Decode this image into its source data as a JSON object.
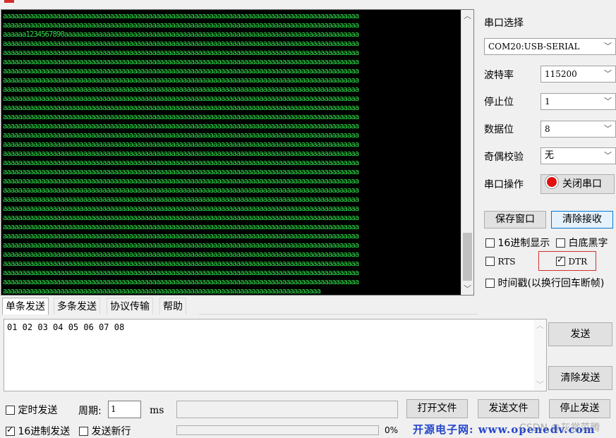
{
  "receive": {
    "lines": [
      "aaaaaaaaaaaaaaaaaaaaaaaaaaaaaaaaaaaaaaaaaaaaaaaaaaaaaaaaaaaaaaaaaaaaaaaaaaaaaaaaaaaaaaaaaaaaa",
      "aaaaaaaaaaaaaaaaaaaaaaaaaaaaaaaaaaaaaaaaaaaaaaaaaaaaaaaaaaaaaaaaaaaaaaaaaaaaaaaaaaaaaaaaaaaaa",
      "aaaaaa1234567890aaaaaaaaaaaaaaaaaaaaaaaaaaaaaaaaaaaaaaaaaaaaaaaaaaaaaaaaaaaaaaaaaaaaaaaaaaaaa",
      "aaaaaaaaaaaaaaaaaaaaaaaaaaaaaaaaaaaaaaaaaaaaaaaaaaaaaaaaaaaaaaaaaaaaaaaaaaaaaaaaaaaaaaaaaaaaa",
      "aaaaaaaaaaaaaaaaaaaaaaaaaaaaaaaaaaaaaaaaaaaaaaaaaaaaaaaaaaaaaaaaaaaaaaaaaaaaaaaaaaaaaaaaaaaaa",
      "aaaaaaaaaaaaaaaaaaaaaaaaaaaaaaaaaaaaaaaaaaaaaaaaaaaaaaaaaaaaaaaaaaaaaaaaaaaaaaaaaaaaaaaaaaaaa",
      "aaaaaaaaaaaaaaaaaaaaaaaaaaaaaaaaaaaaaaaaaaaaaaaaaaaaaaaaaaaaaaaaaaaaaaaaaaaaaaaaaaaaaaaaaaaaa",
      "aaaaaaaaaaaaaaaaaaaaaaaaaaaaaaaaaaaaaaaaaaaaaaaaaaaaaaaaaaaaaaaaaaaaaaaaaaaaaaaaaaaaaaaaaaaaa",
      "aaaaaaaaaaaaaaaaaaaaaaaaaaaaaaaaaaaaaaaaaaaaaaaaaaaaaaaaaaaaaaaaaaaaaaaaaaaaaaaaaaaaaaaaaaaaa",
      "aaaaaaaaaaaaaaaaaaaaaaaaaaaaaaaaaaaaaaaaaaaaaaaaaaaaaaaaaaaaaaaaaaaaaaaaaaaaaaaaaaaaaaaaaaaaa",
      "aaaaaaaaaaaaaaaaaaaaaaaaaaaaaaaaaaaaaaaaaaaaaaaaaaaaaaaaaaaaaaaaaaaaaaaaaaaaaaaaaaaaaaaaaaaaa",
      "aaaaaaaaaaaaaaaaaaaaaaaaaaaaaaaaaaaaaaaaaaaaaaaaaaaaaaaaaaaaaaaaaaaaaaaaaaaaaaaaaaaaaaaaaaaaa",
      "aaaaaaaaaaaaaaaaaaaaaaaaaaaaaaaaaaaaaaaaaaaaaaaaaaaaaaaaaaaaaaaaaaaaaaaaaaaaaaaaaaaaaaaaaaaaa",
      "aaaaaaaaaaaaaaaaaaaaaaaaaaaaaaaaaaaaaaaaaaaaaaaaaaaaaaaaaaaaaaaaaaaaaaaaaaaaaaaaaaaaaaaaaaaaa",
      "aaaaaaaaaaaaaaaaaaaaaaaaaaaaaaaaaaaaaaaaaaaaaaaaaaaaaaaaaaaaaaaaaaaaaaaaaaaaaaaaaaaaaaaaaaaaa",
      "aaaaaaaaaaaaaaaaaaaaaaaaaaaaaaaaaaaaaaaaaaaaaaaaaaaaaaaaaaaaaaaaaaaaaaaaaaaaaaaaaaaaaaaaaaaaa",
      "aaaaaaaaaaaaaaaaaaaaaaaaaaaaaaaaaaaaaaaaaaaaaaaaaaaaaaaaaaaaaaaaaaaaaaaaaaaaaaaaaaaaaaaaaaaaa",
      "aaaaaaaaaaaaaaaaaaaaaaaaaaaaaaaaaaaaaaaaaaaaaaaaaaaaaaaaaaaaaaaaaaaaaaaaaaaaaaaaaaaaaaaaaaaaa",
      "aaaaaaaaaaaaaaaaaaaaaaaaaaaaaaaaaaaaaaaaaaaaaaaaaaaaaaaaaaaaaaaaaaaaaaaaaaaaaaaaaaaaaaaaaaaaa",
      "aaaaaaaaaaaaaaaaaaaaaaaaaaaaaaaaaaaaaaaaaaaaaaaaaaaaaaaaaaaaaaaaaaaaaaaaaaaaaaaaaaaaaaaaaaaaa",
      "aaaaaaaaaaaaaaaaaaaaaaaaaaaaaaaaaaaaaaaaaaaaaaaaaaaaaaaaaaaaaaaaaaaaaaaaaaaaaaaaaaaaaaaaaaaaa",
      "aaaaaaaaaaaaaaaaaaaaaaaaaaaaaaaaaaaaaaaaaaaaaaaaaaaaaaaaaaaaaaaaaaaaaaaaaaaaaaaaaaaaaaaaaaaaa",
      "aaaaaaaaaaaaaaaaaaaaaaaaaaaaaaaaaaaaaaaaaaaaaaaaaaaaaaaaaaaaaaaaaaaaaaaaaaaaaaaaaaaaaaaaaaaaa",
      "aaaaaaaaaaaaaaaaaaaaaaaaaaaaaaaaaaaaaaaaaaaaaaaaaaaaaaaaaaaaaaaaaaaaaaaaaaaaaaaaaaaaaaaaaaaaa",
      "aaaaaaaaaaaaaaaaaaaaaaaaaaaaaaaaaaaaaaaaaaaaaaaaaaaaaaaaaaaaaaaaaaaaaaaaaaaaaaaaaaaaaaaaaaaaa",
      "aaaaaaaaaaaaaaaaaaaaaaaaaaaaaaaaaaaaaaaaaaaaaaaaaaaaaaaaaaaaaaaaaaaaaaaaaaaaaaaaaaaaaaaaaaaaa",
      "aaaaaaaaaaaaaaaaaaaaaaaaaaaaaaaaaaaaaaaaaaaaaaaaaaaaaaaaaaaaaaaaaaaaaaaaaaaaaaaaaaaaaaaaaaaaa",
      "aaaaaaaaaaaaaaaaaaaaaaaaaaaaaaaaaaaaaaaaaaaaaaaaaaaaaaaaaaaaaaaaaaaaaaaaaaaaaaaaaaaaaaaaaaaaa",
      "aaaaaaaaaaaaaaaaaaaaaaaaaaaaaaaaaaaaaaaaaaaaaaaaaaaaaaaaaaaaaaaaaaaaaaaaaaaaaaaaaaaaaaaaaaaaa",
      "aaaaaaaaaaaaaaaaaaaaaaaaaaaaaaaaaaaaaaaaaaaaaaaaaaaaaaaaaaaaaaaaaaaaaaaaaaaaaaaaaaaaaaaaaaaaa",
      "aaaaaaaaaaaaaaaaaaaaaaaaaaaaaaaaaaaaaaaaaaaaaaaaaaaaaaaaaaaaaaaaaaaaaaaaaaaaaaaaaaa"
    ],
    "scrollbar_position": 0.92
  },
  "port_panel": {
    "port_select_label": "串口选择",
    "port_value": "COM20:USB-SERIAL",
    "baud_label": "波特率",
    "baud_value": "115200",
    "stop_label": "停止位",
    "stop_value": "1",
    "data_label": "数据位",
    "data_value": "8",
    "parity_label": "奇偶校验",
    "parity_value": "无",
    "operate_label": "串口操作",
    "close_port_button": "关闭串口",
    "save_window_button": "保存窗口",
    "clear_receive_button": "清除接收",
    "hex_display": {
      "label": "16进制显示",
      "checked": false
    },
    "white_bg": {
      "label": "白底黑字",
      "checked": false
    },
    "rts": {
      "label": "RTS",
      "checked": false
    },
    "dtr": {
      "label": "DTR",
      "checked": true
    },
    "timestamp": {
      "label": "时间戳(以换行回车断帧)",
      "checked": false
    }
  },
  "tabs": [
    "单条发送",
    "多条发送",
    "协议传输",
    "帮助"
  ],
  "send": {
    "text": "01 02 03 04 05 06 07 08",
    "send_button": "发送",
    "clear_send_button": "清除发送"
  },
  "bottom": {
    "timed_send": {
      "label": "定时发送",
      "checked": false
    },
    "period_label": "周期:",
    "period_value": "1",
    "period_unit": "ms",
    "open_file_button": "打开文件",
    "send_file_button": "发送文件",
    "stop_send_button": "停止发送",
    "hex_send": {
      "label": "16进制发送",
      "checked": true
    },
    "send_newline": {
      "label": "发送新行",
      "checked": false
    },
    "progress_text": "0%",
    "banner": "开源电子网: www.openedv.com",
    "watermark": "CSDN @灰常菜腾"
  },
  "colors": {
    "terminal_bg": "#000000",
    "terminal_text": "#2fe04a",
    "banner_blue": "#2244cc",
    "highlight_red": "#d32f2f"
  }
}
